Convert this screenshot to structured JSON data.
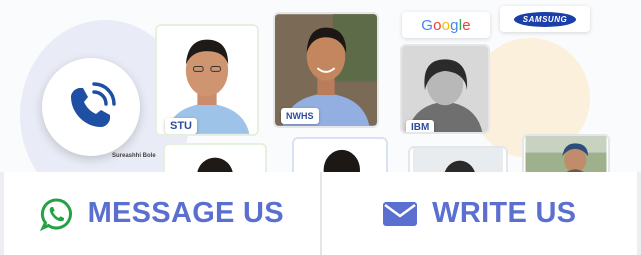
{
  "team_logos": {
    "google": "Google",
    "samsung": "SAMSUNG"
  },
  "profiles": [
    {
      "tag": "STU"
    },
    {
      "tag": "NWHS"
    },
    {
      "tag": "IBM"
    }
  ],
  "caption": "Sureashhi Bole",
  "actions": {
    "message_label": "MESSAGE US",
    "write_label": "WRITE US"
  },
  "colors": {
    "accent": "#5a6fd0",
    "whatsapp": "#25a244",
    "phone": "#1f4fa3",
    "mail": "#5a6fd0"
  },
  "icons": {
    "call": "phone-call-icon",
    "message": "whatsapp-icon",
    "write": "envelope-icon"
  }
}
